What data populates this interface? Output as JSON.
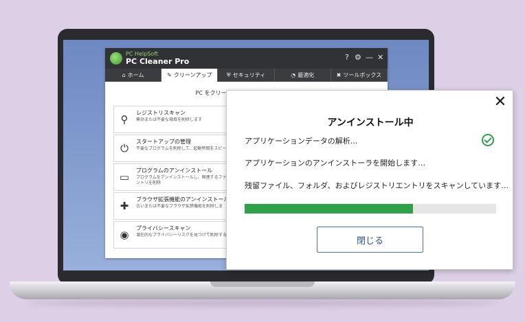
{
  "app": {
    "brand_sub": "PC HelpSoft",
    "brand_name": "PC Cleaner Pro",
    "controls": {
      "help": "?",
      "settings": "⚙",
      "minimize": "—",
      "close": "✕"
    },
    "tabs": [
      {
        "label": "ホーム",
        "icon": "home-icon"
      },
      {
        "label": "クリーンアップ",
        "icon": "broom-icon"
      },
      {
        "label": "セキュリティ",
        "icon": "shield-icon"
      },
      {
        "label": "最適化",
        "icon": "speedometer-icon"
      },
      {
        "label": "ツールボックス",
        "icon": "tools-icon"
      }
    ],
    "active_tab": "クリーンアップ",
    "intro": "PC をクリーンアップしてジャンクファイ",
    "features": [
      {
        "title": "レジストリスキャン",
        "desc": "無効または不要な項目を削除します",
        "icon": "registry-scan-icon"
      },
      {
        "title": "スタートアップの管理",
        "desc": "不要なプログラムを削除して、起動時間をスピー する",
        "icon": "power-icon"
      },
      {
        "title": "プログラムのアンインストール",
        "desc": "プログラムをアンインストールし、関連するファイル、 トリエントリを削除",
        "icon": "uninstall-icon"
      },
      {
        "title": "ブラウザ拡張機能のアンインストール",
        "desc": "古いまたは不要なブラウザ拡張機能を削除しま",
        "icon": "puzzle-icon"
      },
      {
        "title": "プライバシースキャン",
        "desc": "潜在的なプライバシーリスクを見つけて削除する",
        "icon": "eye-icon"
      }
    ]
  },
  "dialog": {
    "title": "アンインストール中",
    "close": "✕",
    "steps": [
      {
        "text": "アプリケーションデータの解析...",
        "done": true
      },
      {
        "text": "アプリケーションのアンインストーラを開始します…",
        "done": false
      },
      {
        "text": "残留ファイル、フォルダ、およびレジストリエントリをスキャンしています…",
        "done": false
      }
    ],
    "progress_percent": 67,
    "close_button": "閉じる",
    "colors": {
      "progress": "#2fa148",
      "button_border": "#4b6fb5"
    }
  }
}
